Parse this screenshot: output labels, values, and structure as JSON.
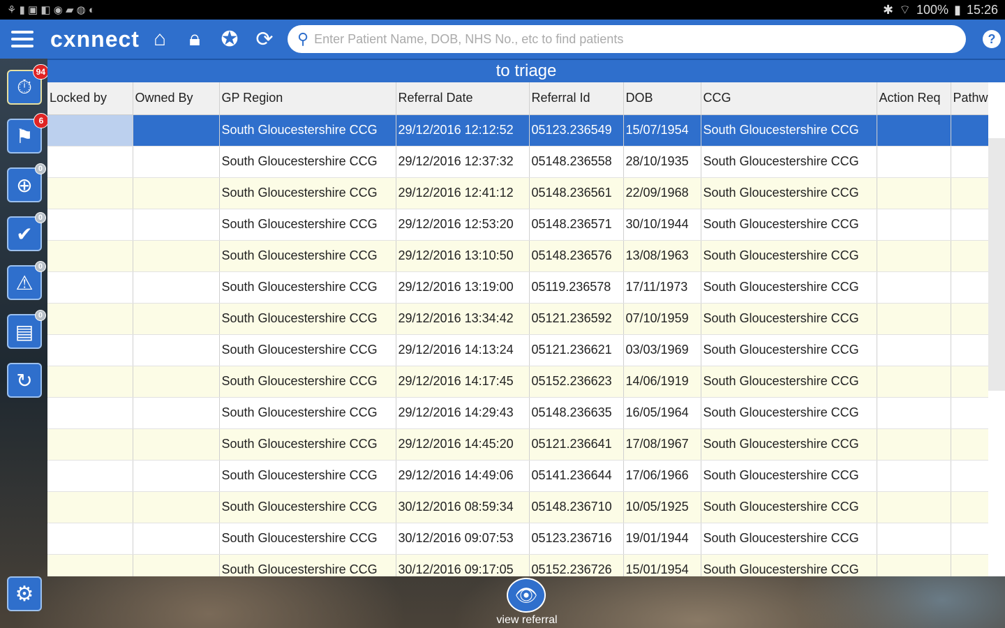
{
  "status_bar": {
    "left_icons": [
      "notification-icons"
    ],
    "battery": "100%",
    "time": "15:26"
  },
  "header": {
    "logo": "cxnnect",
    "search_placeholder": "Enter Patient Name, DOB, NHS No., etc to find patients",
    "help": "?"
  },
  "sidebar": {
    "badges": [
      "94",
      "6",
      "0",
      "0",
      "0",
      "0"
    ]
  },
  "panel": {
    "title": "to triage",
    "columns": [
      "Locked by",
      "Owned By",
      "GP Region",
      "Referral Date",
      "Referral Id",
      "DOB",
      "CCG",
      "Action Req",
      "Pathw"
    ],
    "rows": [
      [
        "",
        "",
        "South Gloucestershire CCG",
        "29/12/2016 12:12:52",
        "05123.236549",
        "15/07/1954",
        "South Gloucestershire CCG",
        "",
        ""
      ],
      [
        "",
        "",
        "South Gloucestershire CCG",
        "29/12/2016 12:37:32",
        "05148.236558",
        "28/10/1935",
        "South Gloucestershire CCG",
        "",
        ""
      ],
      [
        "",
        "",
        "South Gloucestershire CCG",
        "29/12/2016 12:41:12",
        "05148.236561",
        "22/09/1968",
        "South Gloucestershire CCG",
        "",
        ""
      ],
      [
        "",
        "",
        "South Gloucestershire CCG",
        "29/12/2016 12:53:20",
        "05148.236571",
        "30/10/1944",
        "South Gloucestershire CCG",
        "",
        ""
      ],
      [
        "",
        "",
        "South Gloucestershire CCG",
        "29/12/2016 13:10:50",
        "05148.236576",
        "13/08/1963",
        "South Gloucestershire CCG",
        "",
        ""
      ],
      [
        "",
        "",
        "South Gloucestershire CCG",
        "29/12/2016 13:19:00",
        "05119.236578",
        "17/11/1973",
        "South Gloucestershire CCG",
        "",
        ""
      ],
      [
        "",
        "",
        "South Gloucestershire CCG",
        "29/12/2016 13:34:42",
        "05121.236592",
        "07/10/1959",
        "South Gloucestershire CCG",
        "",
        ""
      ],
      [
        "",
        "",
        "South Gloucestershire CCG",
        "29/12/2016 14:13:24",
        "05121.236621",
        "03/03/1969",
        "South Gloucestershire CCG",
        "",
        ""
      ],
      [
        "",
        "",
        "South Gloucestershire CCG",
        "29/12/2016 14:17:45",
        "05152.236623",
        "14/06/1919",
        "South Gloucestershire CCG",
        "",
        ""
      ],
      [
        "",
        "",
        "South Gloucestershire CCG",
        "29/12/2016 14:29:43",
        "05148.236635",
        "16/05/1964",
        "South Gloucestershire CCG",
        "",
        ""
      ],
      [
        "",
        "",
        "South Gloucestershire CCG",
        "29/12/2016 14:45:20",
        "05121.236641",
        "17/08/1967",
        "South Gloucestershire CCG",
        "",
        ""
      ],
      [
        "",
        "",
        "South Gloucestershire CCG",
        "29/12/2016 14:49:06",
        "05141.236644",
        "17/06/1966",
        "South Gloucestershire CCG",
        "",
        ""
      ],
      [
        "",
        "",
        "South Gloucestershire CCG",
        "30/12/2016 08:59:34",
        "05148.236710",
        "10/05/1925",
        "South Gloucestershire CCG",
        "",
        ""
      ],
      [
        "",
        "",
        "South Gloucestershire CCG",
        "30/12/2016 09:07:53",
        "05123.236716",
        "19/01/1944",
        "South Gloucestershire CCG",
        "",
        ""
      ],
      [
        "",
        "",
        "South Gloucestershire CCG",
        "30/12/2016 09:17:05",
        "05152.236726",
        "15/01/1954",
        "South Gloucestershire CCG",
        "",
        ""
      ]
    ],
    "selected_row": 0
  },
  "bottom": {
    "view_label": "view referral"
  },
  "colors": {
    "accent": "#2f6fcc",
    "row_alt": "#fcfce6",
    "badge": "#e02424"
  }
}
